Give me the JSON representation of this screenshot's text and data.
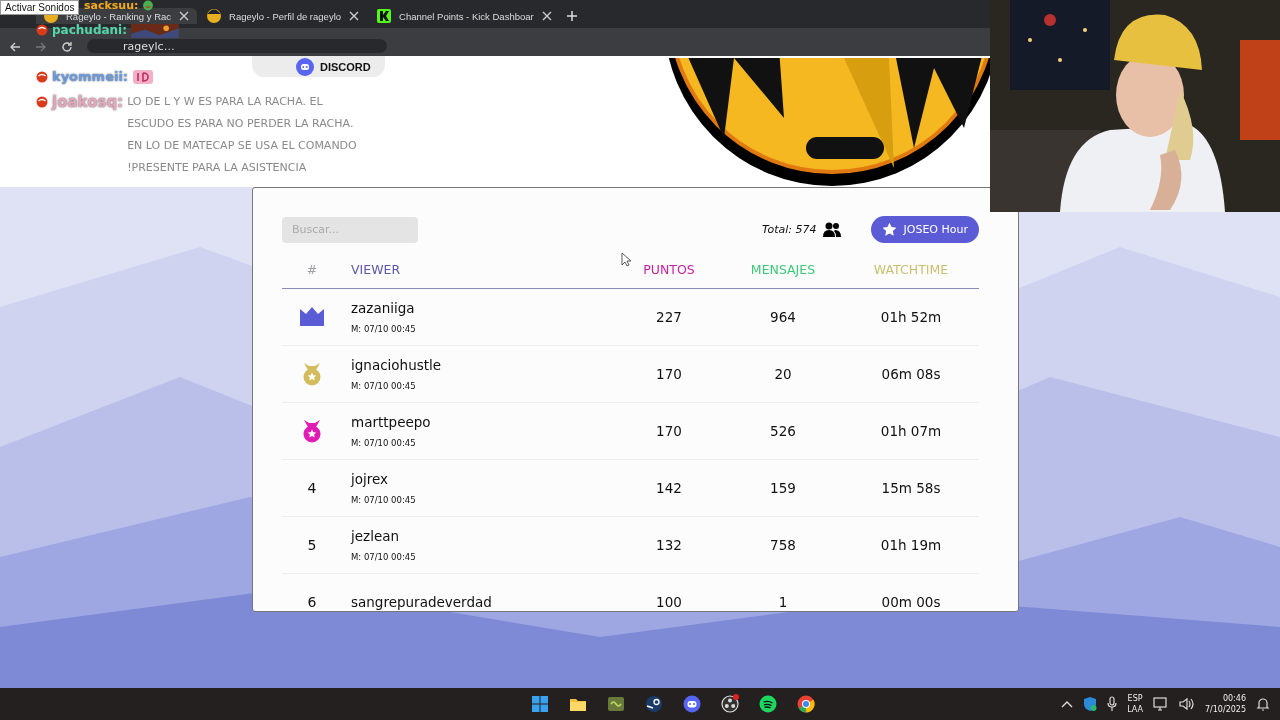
{
  "sound_button": "Activar Sonidos",
  "browser": {
    "tabs": [
      {
        "title": "Rageylo - Ranking y Rac",
        "selected": true
      },
      {
        "title": "Rageylo - Perfil de rageylo",
        "selected": false
      },
      {
        "title": "Channel Points - Kick Dashboar",
        "selected": false
      }
    ],
    "address": "rageylc…"
  },
  "chat": [
    {
      "user": "sacksuu:",
      "color": "#f0a81c"
    },
    {
      "user": "pachudani:",
      "color": "#52d6a8"
    },
    {
      "user": "kyommeii:",
      "color": "#6a9be0"
    },
    {
      "user": "joakosq:",
      "color": "#e6a6bc",
      "message": "LO DE L Y W ES PARA LA RACHA. EL ESCUDO ES PARA NO PERDER LA RACHA. EN LO DE MATECAP SE USA EL COMANDO !PRESENTE PARA LA ASISTENCIA"
    }
  ],
  "discord_button": "DISCORD",
  "leaderboard": {
    "search_placeholder": "Buscar...",
    "total": "Total: 574",
    "hour_button": "JOSEO Hour",
    "columns": [
      {
        "label": "#",
        "color": "#a0a0a8"
      },
      {
        "label": "VIEWER",
        "color": "#5a58a8"
      },
      {
        "label": "PUNTOS",
        "color": "#c81ea0"
      },
      {
        "label": "MENSAJES",
        "color": "#3cc878"
      },
      {
        "label": "WATCHTIME",
        "color": "#c8c070"
      }
    ],
    "rows": [
      {
        "kind": "crown",
        "color": "#5b5bd6",
        "name": "zazaniiga",
        "date": "M: 07/10 00:45",
        "points": "227",
        "messages": "964",
        "watchtime": "01h 52m"
      },
      {
        "kind": "medal",
        "color": "#d4bc5c",
        "name": "ignaciohustle",
        "date": "M: 07/10 00:45",
        "points": "170",
        "messages": "20",
        "watchtime": "06m 08s"
      },
      {
        "kind": "medal",
        "color": "#e01cb4",
        "name": "marttpeepo",
        "date": "M: 07/10 00:45",
        "points": "170",
        "messages": "526",
        "watchtime": "01h 07m"
      },
      {
        "kind": "number",
        "rank": "4",
        "name": "jojrex",
        "date": "M: 07/10 00:45",
        "points": "142",
        "messages": "159",
        "watchtime": "15m 58s"
      },
      {
        "kind": "number",
        "rank": "5",
        "name": "jezlean",
        "date": "M: 07/10 00:45",
        "points": "132",
        "messages": "758",
        "watchtime": "01h 19m"
      },
      {
        "kind": "number",
        "rank": "6",
        "name": "sangrepuradeverdad",
        "points": "100",
        "messages": "1",
        "watchtime": "00m 00s"
      }
    ]
  },
  "taskbar": {
    "language": [
      "ESP",
      "LAA"
    ],
    "time": "00:46",
    "date": "7/10/2025"
  }
}
